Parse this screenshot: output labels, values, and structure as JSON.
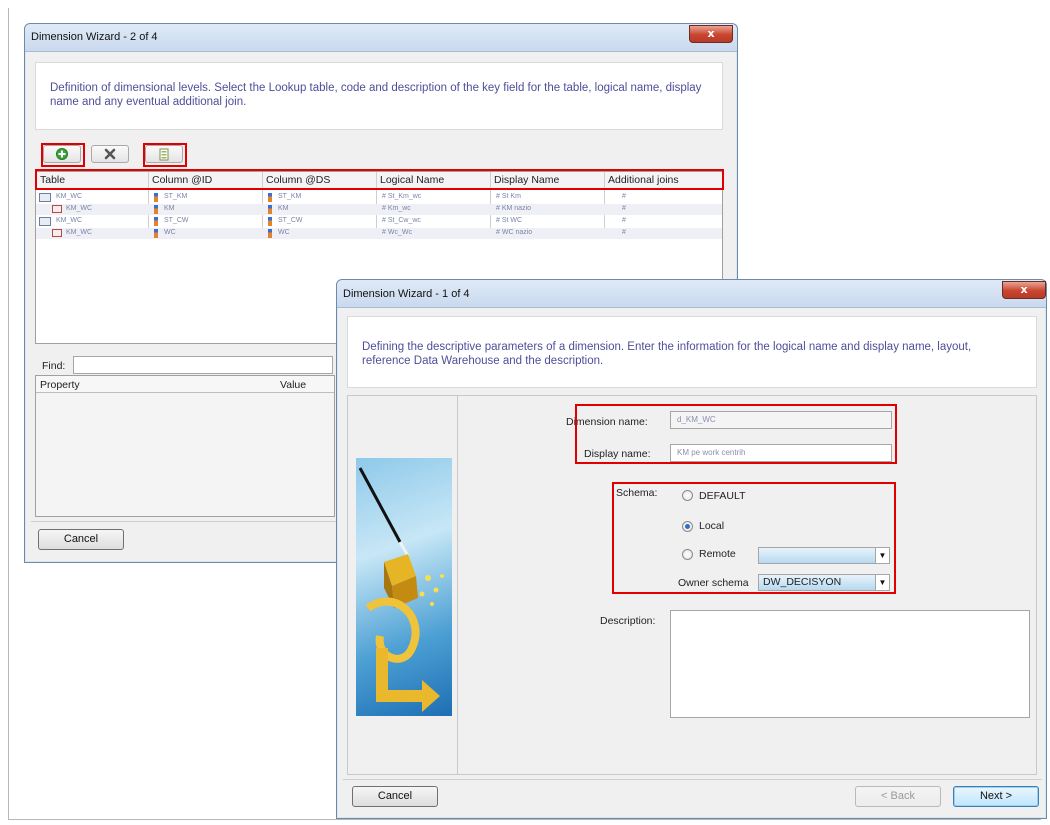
{
  "wizard2": {
    "title": "Dimension Wizard - 2 of 4",
    "close_label": "x",
    "description": "Definition of dimensional levels. Select the Lookup table, code and description of the key field for the table, logical name, display name and any eventual additional join.",
    "toolbar": {
      "add_icon": "add-icon",
      "delete_icon": "delete-icon",
      "properties_icon": "properties-icon"
    },
    "columns": [
      "Table",
      "Column @ID",
      "Column @DS",
      "Logical Name",
      "Display Name",
      "Additional joins"
    ],
    "rows": [
      [
        "KM_WC",
        "ST_KM",
        "ST_KM",
        "# St_Km_wc",
        "# St Km",
        "#"
      ],
      [
        "KM_WC",
        "KM",
        "KM",
        "# Km_wc",
        "# KM nazio",
        "#"
      ],
      [
        "KM_WC",
        "ST_CW",
        "ST_CW",
        "# St_Cw_wc",
        "# St WC",
        "#"
      ],
      [
        "KM_WC",
        "WC",
        "WC",
        "# Wc_Wc",
        "# WC nazio",
        "#"
      ]
    ],
    "find_label": "Find:",
    "find_value": "",
    "property_header": "Property",
    "value_header": "Value",
    "cancel_label": "Cancel"
  },
  "wizard1": {
    "title": "Dimension Wizard - 1 of 4",
    "close_label": "x",
    "description": "Defining the descriptive parameters of a dimension. Enter the information for the logical name and display name, layout, reference Data Warehouse and the description.",
    "dimension_name_label": "Dimension name:",
    "dimension_name_value": "d_KM_WC",
    "display_name_label": "Display name:",
    "display_name_value": "KM pe work centrih",
    "schema_label": "Schema:",
    "schema_options": [
      "DEFAULT",
      "Local",
      "Remote"
    ],
    "schema_selected": "Local",
    "remote_value": "",
    "owner_schema_label": "Owner schema",
    "owner_schema_value": "DW_DECISYON",
    "description_label": "Description:",
    "description_value": "",
    "cancel_label": "Cancel",
    "back_label": "< Back",
    "next_label": "Next >"
  }
}
